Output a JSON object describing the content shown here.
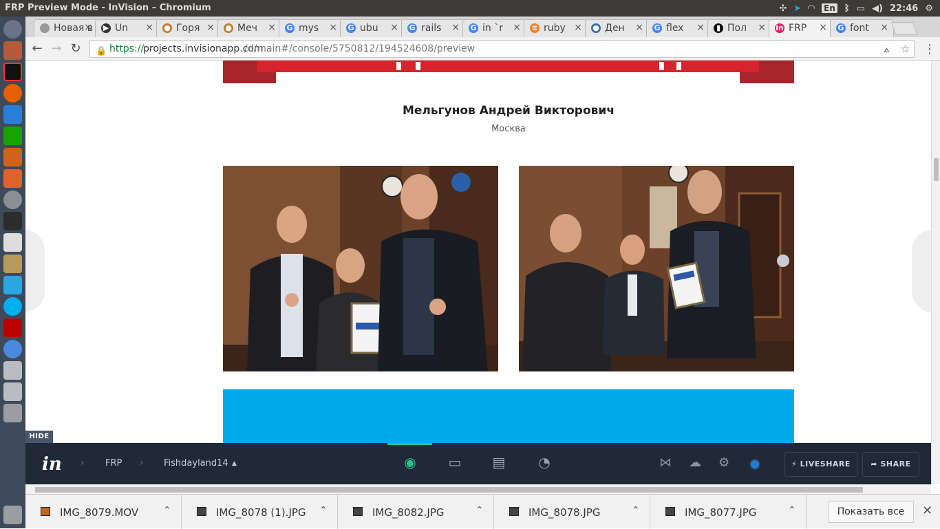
{
  "window": {
    "title": "FRP Preview Mode - InVision – Chromium"
  },
  "tray": {
    "lang": "En",
    "time": "22:46"
  },
  "tabs": [
    {
      "label": "Новая в",
      "color": "#999999",
      "glyph": ""
    },
    {
      "label": "Un",
      "color": "#333333",
      "glyph": "▶"
    },
    {
      "label": "Горя",
      "color": "#c07a2c",
      "glyph": "●"
    },
    {
      "label": "Меч",
      "color": "#c07a2c",
      "glyph": "●"
    },
    {
      "label": "mys",
      "color": "#4285f4",
      "glyph": "G"
    },
    {
      "label": "ubu",
      "color": "#4285f4",
      "glyph": "G"
    },
    {
      "label": "rails",
      "color": "#4285f4",
      "glyph": "G"
    },
    {
      "label": "in `r",
      "color": "#4285f4",
      "glyph": "G"
    },
    {
      "label": "ruby",
      "color": "#f48024",
      "glyph": "≡"
    },
    {
      "label": "Ден",
      "color": "#3a6ea5",
      "glyph": "●"
    },
    {
      "label": "flex",
      "color": "#4285f4",
      "glyph": "G"
    },
    {
      "label": "Пол",
      "color": "#111111",
      "glyph": "▮"
    },
    {
      "label": "FRP",
      "color": "#e0245e",
      "glyph": "in"
    },
    {
      "label": "font",
      "color": "#4285f4",
      "glyph": "G"
    }
  ],
  "address": {
    "scheme": "https://",
    "host": "projects.invisionapp.com",
    "path": "/d/main#/console/5750812/194524608/preview"
  },
  "content": {
    "person_name": "Мельгунов Андрей Викторович",
    "city": "Москва"
  },
  "invision": {
    "hide_label": "HIDE",
    "logo": "in",
    "project": "FRP",
    "screen": "Fishdayland14",
    "liveshare_label": "LIVESHARE",
    "share_label": "SHARE"
  },
  "downloads": {
    "items": [
      "IMG_8079.MOV",
      "IMG_8078 (1).JPG",
      "IMG_8082.JPG",
      "IMG_8078.JPG",
      "IMG_8077.JPG"
    ],
    "show_all_label": "Показать все"
  }
}
